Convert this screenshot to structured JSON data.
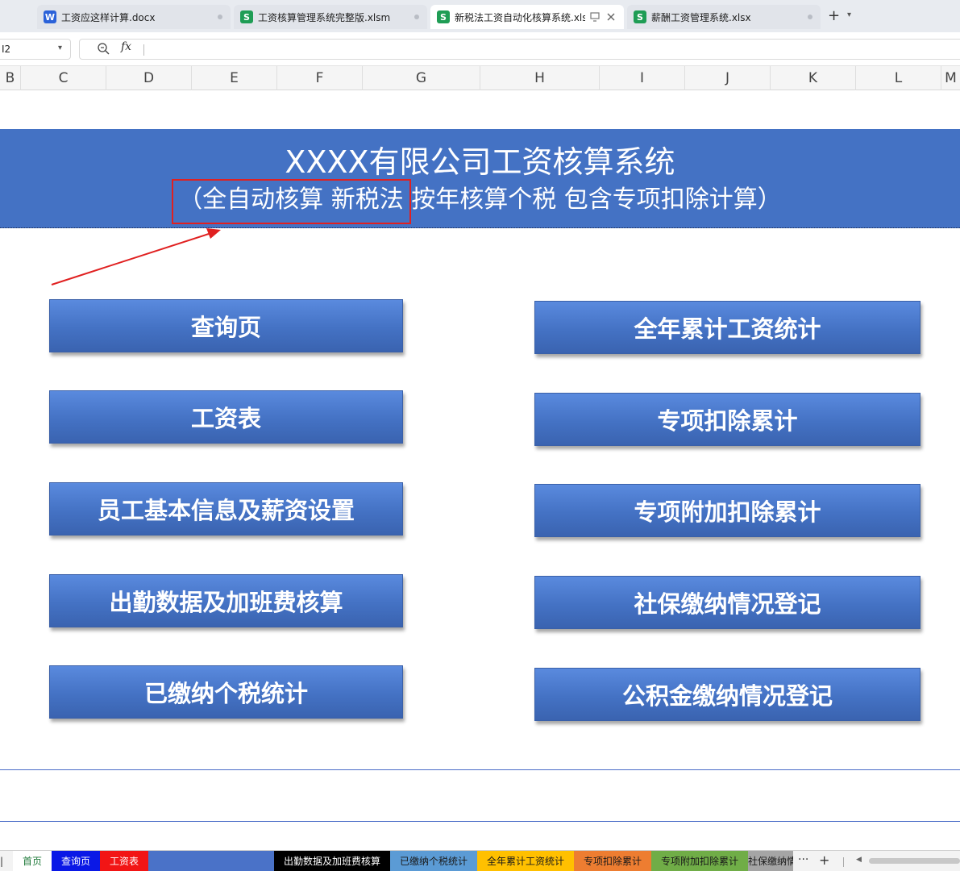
{
  "doc_tabs": [
    {
      "label": "工资应这样计算.docx",
      "icon": "W"
    },
    {
      "label": "工资核算管理系统完整版.xlsm",
      "icon": "S"
    },
    {
      "label": "新税法工资自动化核算系统.xls",
      "icon": "S"
    },
    {
      "label": "薪酬工资管理系统.xlsx",
      "icon": "S"
    }
  ],
  "formula": {
    "name_box": "I2",
    "fx_label": "fx"
  },
  "columns": [
    "B",
    "C",
    "D",
    "E",
    "F",
    "G",
    "H",
    "I",
    "J",
    "K",
    "L",
    "M"
  ],
  "banner": {
    "title": "XXXX有限公司工资核算系统",
    "subtitle": "（全自动核算  新税法 按年核算个税 包含专项扣除计算）"
  },
  "buttons_left": [
    "查询页",
    "工资表",
    "员工基本信息及薪资设置",
    "出勤数据及加班费核算",
    "已缴纳个税统计"
  ],
  "buttons_right": [
    "全年累计工资统计",
    "专项扣除累计",
    "专项附加扣除累计",
    "社保缴纳情况登记",
    "公积金缴纳情况登记"
  ],
  "sheet_tabs": [
    {
      "label": "首页",
      "bg": "#ffffff",
      "fg": "#1f7a3a"
    },
    {
      "label": "查询页",
      "bg": "#0a18e6",
      "fg": "#ffffff"
    },
    {
      "label": "工资表",
      "bg": "#f21515",
      "fg": "#ffffff"
    },
    {
      "label": "",
      "bg": "#4a72c8",
      "fg": "#ffffff"
    },
    {
      "label": "出勤数据及加班费核算",
      "bg": "#000000",
      "fg": "#ffffff"
    },
    {
      "label": "已缴纳个税统计",
      "bg": "#5b9bd5",
      "fg": "#1a1a1a"
    },
    {
      "label": "全年累计工资统计",
      "bg": "#ffc000",
      "fg": "#1a1a1a"
    },
    {
      "label": "专项扣除累计",
      "bg": "#ed7d31",
      "fg": "#1a1a1a"
    },
    {
      "label": "专项附加扣除累计",
      "bg": "#70ad47",
      "fg": "#1a1a1a"
    },
    {
      "label": "社保缴纳情",
      "bg": "#a5a5a5",
      "fg": "#1a1a1a"
    }
  ],
  "sheet_controls": {
    "more": "···",
    "add": "+"
  },
  "colors": {
    "banner": "#4472c4",
    "button": "#4472c4",
    "highlight": "#e02020"
  }
}
